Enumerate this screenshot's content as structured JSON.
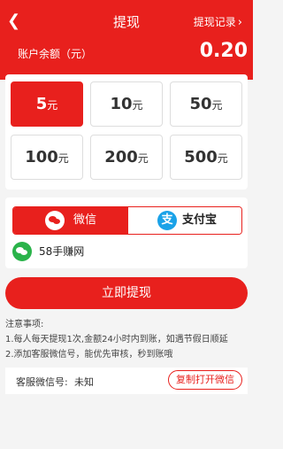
{
  "header": {
    "back_icon": "chevron-left-icon",
    "title": "提现",
    "record_label": "提现记录",
    "record_icon": "chevron-right-icon"
  },
  "balance": {
    "label": "账户余额（元）",
    "value": "0.20"
  },
  "amounts": [
    {
      "num": "5",
      "unit": "元",
      "selected": true
    },
    {
      "num": "10",
      "unit": "元",
      "selected": false
    },
    {
      "num": "50",
      "unit": "元",
      "selected": false
    },
    {
      "num": "100",
      "unit": "元",
      "selected": false
    },
    {
      "num": "200",
      "unit": "元",
      "selected": false
    },
    {
      "num": "500",
      "unit": "元",
      "selected": false
    }
  ],
  "payment": {
    "wechat_label": "微信",
    "alipay_label": "支付宝",
    "alipay_glyph": "支",
    "account_name": "58手赚网",
    "selected": "wechat"
  },
  "submit_label": "立即提现",
  "notes": {
    "title": "注意事项:",
    "line1": "1.每人每天提现1次,金额24小时内到账，如遇节假日顺延",
    "line2": "2.添加客服微信号，能优先审核，秒到账哦"
  },
  "service": {
    "label": "客服微信号:",
    "value": "未知",
    "copy_label": "复制打开微信"
  },
  "colors": {
    "accent": "#e8201d",
    "alipay": "#1aa2e8",
    "wechat_green": "#2ab34a"
  }
}
